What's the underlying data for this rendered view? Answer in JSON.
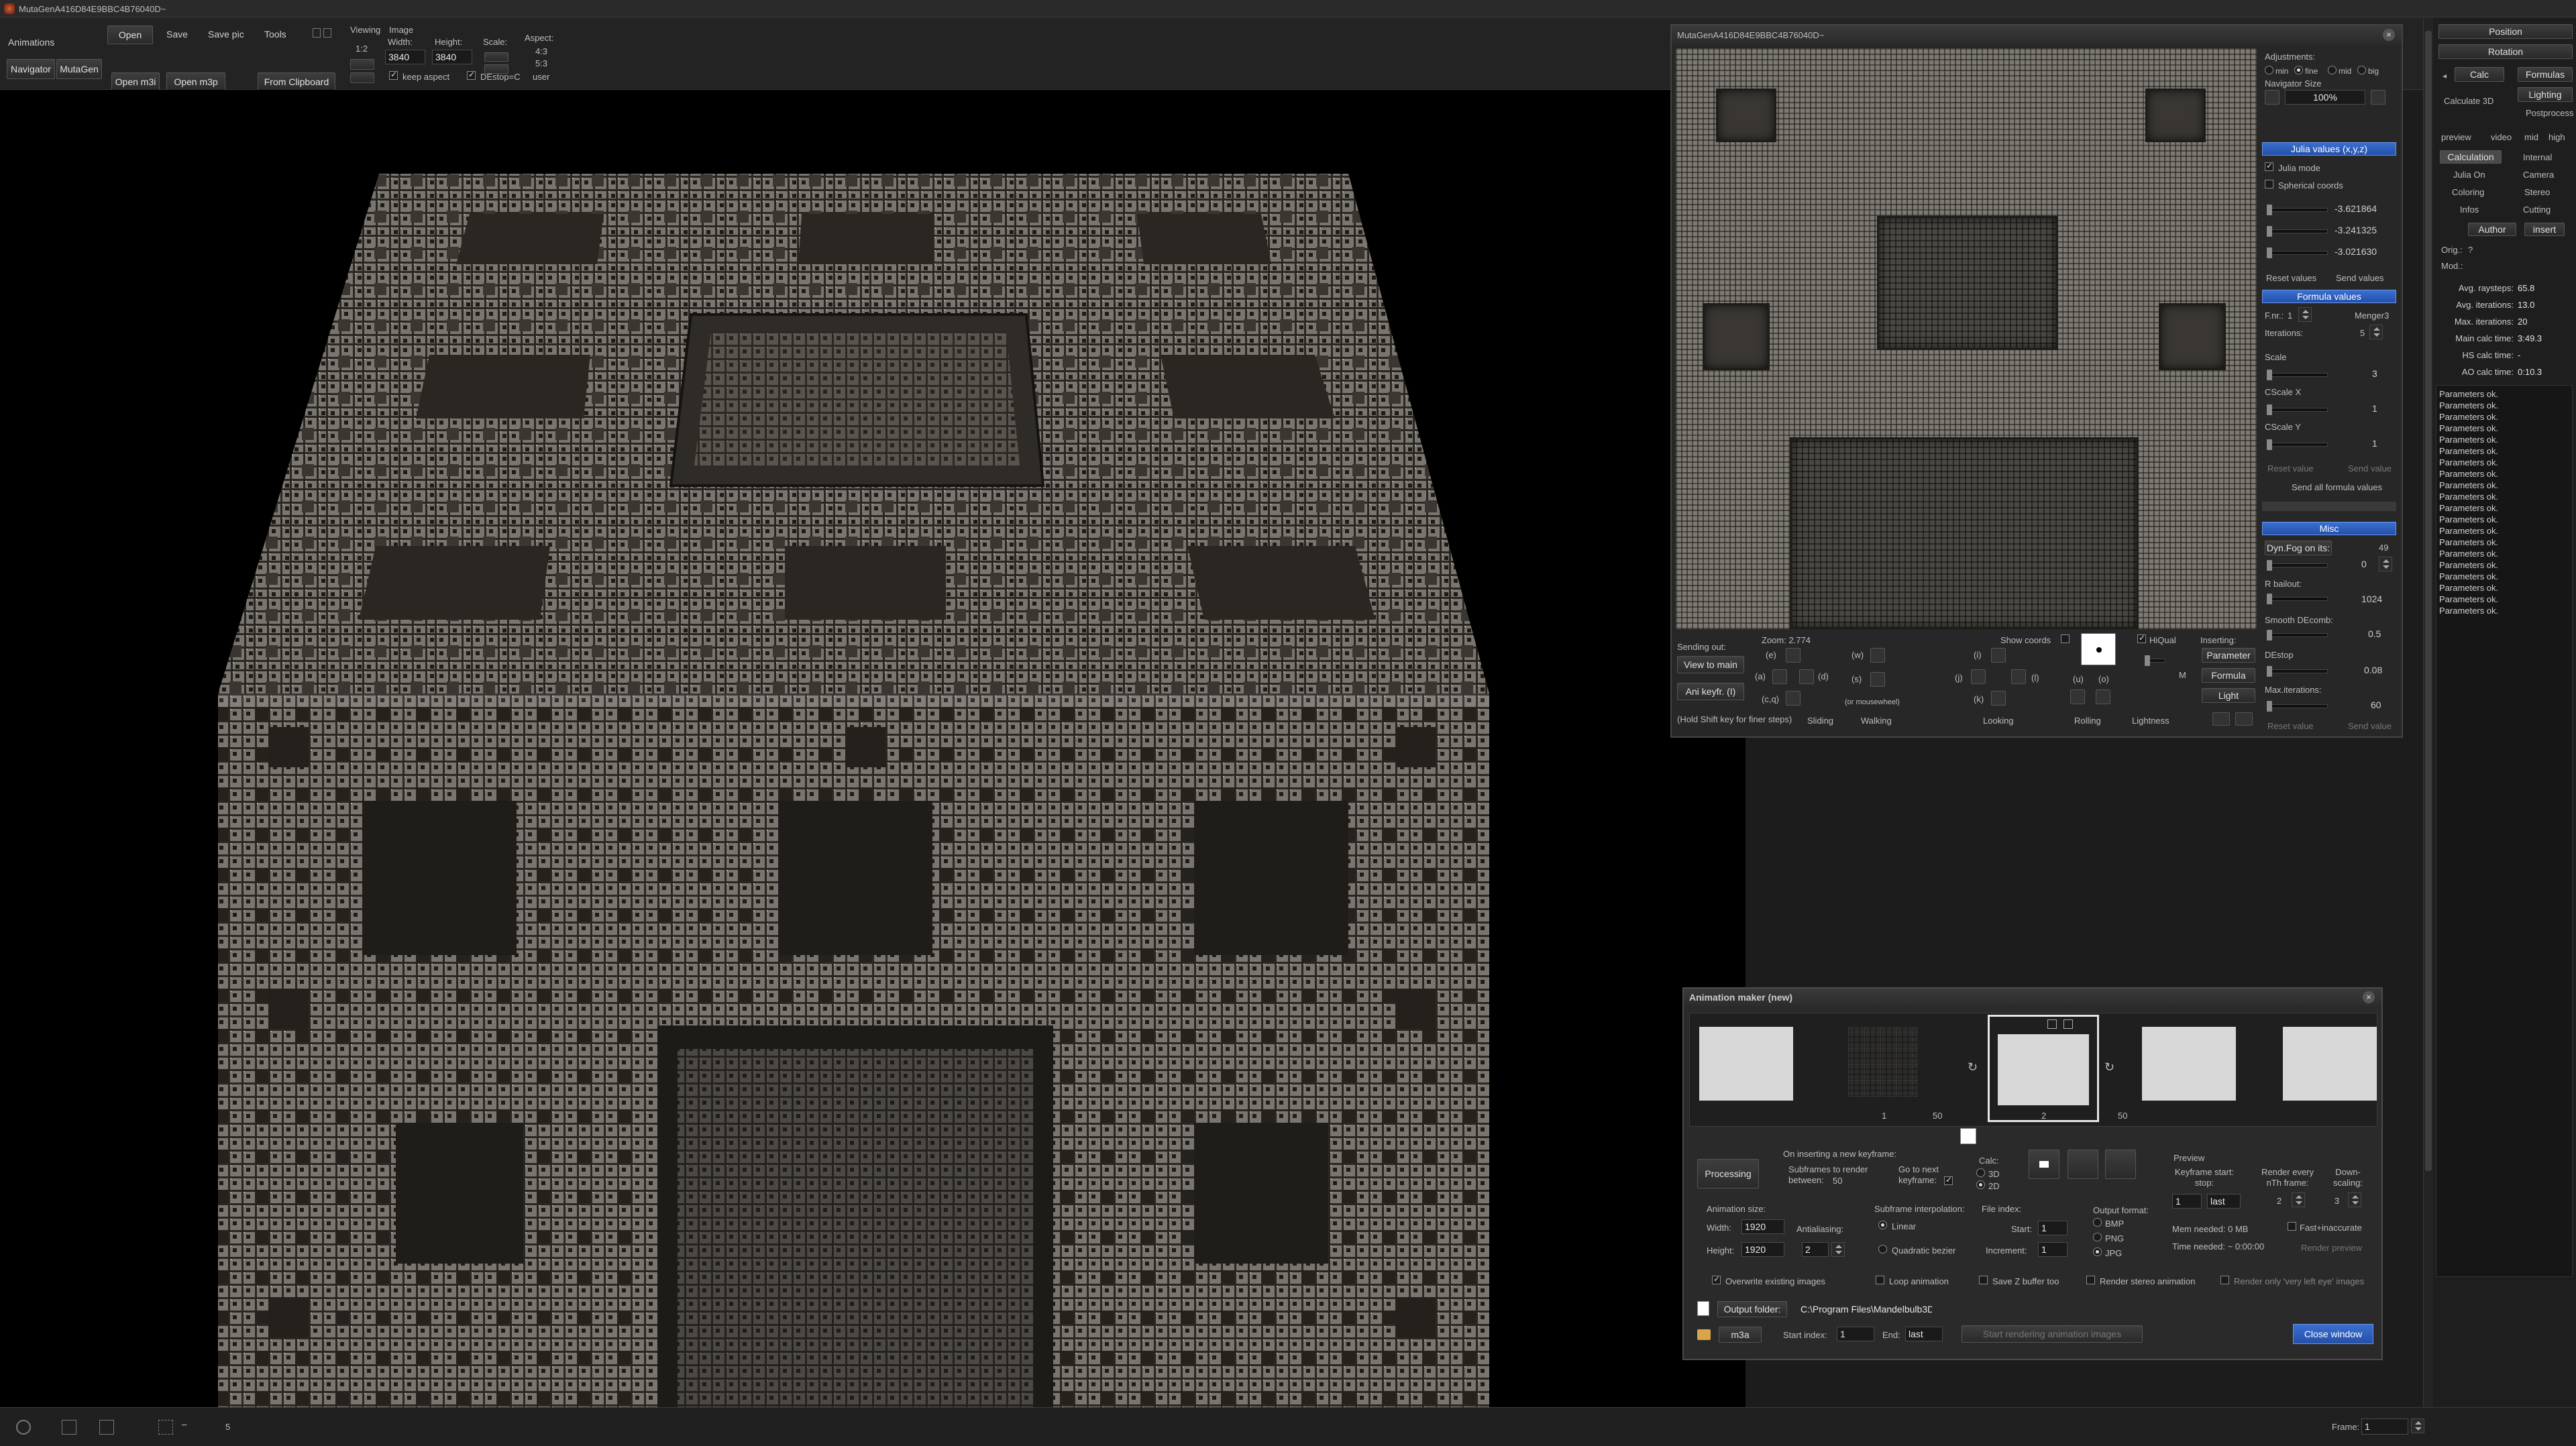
{
  "window_title": "MutaGenA416D84E9BBC4B76040D~",
  "toolbar": {
    "animations": "Animations",
    "navigator": "Navigator",
    "mutagen": "MutaGen",
    "open": "Open",
    "save": "Save",
    "save_pic": "Save pic",
    "tools": "Tools",
    "open_m3i": "Open m3i",
    "open_m3p": "Open m3p",
    "from_clipboard": "From Clipboard",
    "viewing_label": "Viewing",
    "viewing_value": "1:2",
    "image_label": "Image",
    "width_label": "Width:",
    "width_value": "3840",
    "height_label": "Height:",
    "height_value": "3840",
    "scale_label": "Scale:",
    "aspect_label": "Aspect:",
    "aspect_options": [
      "4:3",
      "5:3",
      "user"
    ],
    "keep_aspect": "keep aspect",
    "destop_c": "DEstop=C"
  },
  "navigator": {
    "title": "MutaGenA416D84E9BBC4B76040D~",
    "adjustments_label": "Adjustments:",
    "adj_options": [
      "min",
      "fine",
      "mid",
      "big"
    ],
    "navigator_size_label": "Navigator Size",
    "navigator_size_value": "100%",
    "julia_values_bar": "Julia values (x,y,z)",
    "julia_mode": "Julia mode",
    "spherical_coords": "Spherical coords",
    "julia_x": "-3.621864",
    "julia_y": "-3.241325",
    "julia_z": "-3.021630",
    "reset_values": "Reset values",
    "send_values": "Send values",
    "formula_values_bar": "Formula values",
    "fnr_label": "F.nr.:",
    "fnr_value": "1",
    "formula_name": "Menger3",
    "iterations_label": "Iterations:",
    "iterations_value": "5",
    "scale_label": "Scale",
    "scale_value": "3",
    "cscalex_label": "CScale X",
    "cscalex_value": "1",
    "cscaley_label": "CScale Y",
    "cscaley_value": "1",
    "reset_value": "Reset value",
    "send_value": "Send value",
    "send_all_formula": "Send all formula values",
    "misc_bar": "Misc",
    "dyn_fog_label": "Dyn.Fog on its:",
    "dyn_fog_value": "49",
    "dyn_fog_slider_value": "0",
    "rbailout_label": "R bailout:",
    "rbailout_value": "1024",
    "smooth_label": "Smooth DEcomb:",
    "smooth_value": "0.5",
    "destop_label": "DEstop",
    "destop_value": "0.08",
    "max_iter_label": "Max.iterations:",
    "max_iter_value": "60",
    "reset_value2": "Reset value",
    "send_value2": "Send value",
    "sending_out": "Sending out:",
    "view_to_main": "View to main",
    "ani_keyfr": "Ani keyfr. (I)",
    "zoom_label": "Zoom: 2.774",
    "show_coords": "Show coords",
    "hiqual": "HiQual",
    "inserting": "Inserting:",
    "parameter": "Parameter",
    "formula": "Formula",
    "light": "Light",
    "hold_shift": "(Hold Shift key for finer steps)",
    "sliding": "Sliding",
    "walking": "Walking",
    "looking": "Looking",
    "rolling": "Rolling",
    "lightness": "Lightness",
    "or_mousewheel": "(or mousewheel)",
    "key_labels": [
      "(e)",
      "(w)",
      "(i)",
      "(a)",
      "(d)",
      "(s)",
      "(j)",
      "(l)",
      "(u)",
      "(o)",
      "(c,q)",
      "(k)",
      "M"
    ]
  },
  "right_panel": {
    "position": "Position",
    "rotation": "Rotation",
    "calc": "Calc",
    "formulas": "Formulas",
    "calculate_3d": "Calculate 3D",
    "lighting": "Lighting",
    "postprocess": "Postprocess",
    "preview": "preview",
    "video": "video",
    "mid": "mid",
    "high": "high",
    "tabs": [
      "Calculation",
      "Internal",
      "Julia On",
      "Camera",
      "Coloring",
      "Stereo",
      "Infos",
      "Cutting"
    ],
    "author": "Author",
    "insert": "insert",
    "orig_label": "Orig.:",
    "orig_value": "?",
    "mod_label": "Mod.:",
    "stats": [
      {
        "label": "Avg. raysteps:",
        "value": "65.8"
      },
      {
        "label": "Avg. iterations:",
        "value": "13.0"
      },
      {
        "label": "Max. iterations:",
        "value": "20"
      },
      {
        "label": "Main calc time:",
        "value": "3:49.3"
      },
      {
        "label": "HS calc time:",
        "value": "-"
      },
      {
        "label": "AO calc time:",
        "value": "0:10.3"
      }
    ],
    "log": [
      "Parameters ok.",
      "Parameters ok.",
      "Parameters ok.",
      "Parameters ok.",
      "Parameters ok.",
      "Parameters ok.",
      "Parameters ok.",
      "Parameters ok.",
      "Parameters ok.",
      "Parameters ok.",
      "Parameters ok.",
      "Parameters ok.",
      "Parameters ok.",
      "Parameters ok.",
      "Parameters ok.",
      "Parameters ok.",
      "Parameters ok.",
      "Parameters ok.",
      "Parameters ok.",
      "Parameters ok."
    ]
  },
  "animation_maker": {
    "title": "Animation maker  (new)",
    "frame_numbers": [
      "1",
      "50",
      "2",
      "50"
    ],
    "processing": "Processing",
    "on_inserting": "On inserting a new keyframe:",
    "subframes_label": "Subframes to render between:",
    "subframes_value": "50",
    "go_to_next": "Go to next keyframe:",
    "calc_label": "Calc:",
    "calc_3d": "3D",
    "calc_2d": "2D",
    "preview_label": "Preview",
    "keyframe_label": "Keyframe start:  stop:",
    "keyframe_start": "1",
    "keyframe_stop": "last",
    "render_every_label": "Render every nTh frame:",
    "render_every_value": "2",
    "downscaling_label": "Down-scaling:",
    "downscaling_value": "3",
    "animation_size": "Animation size:",
    "width_label": "Width:",
    "width_value": "1920",
    "height_label": "Height:",
    "height_value": "1920",
    "antialiasing_label": "Antialiasing:",
    "antialiasing_value": "2",
    "subframe_interp": "Subframe interpolation:",
    "linear": "Linear",
    "quadratic": "Quadratic bezier",
    "file_index": "File index:",
    "start_label": "Start:",
    "start_value": "1",
    "increment_label": "Increment:",
    "increment_value": "1",
    "output_format": "Output format:",
    "formats": [
      "BMP",
      "PNG",
      "JPG"
    ],
    "mem_needed": "Mem needed:  0 MB",
    "time_needed": "Time needed:  ~ 0:00:00",
    "fast_inaccurate": "Fast+inaccurate",
    "render_preview": "Render preview",
    "overwrite": "Overwrite existing images",
    "loop": "Loop animation",
    "save_z": "Save Z buffer too",
    "render_stereo": "Render stereo animation",
    "render_only_left": "Render only 'very left eye' images",
    "output_folder": "Output folder:",
    "output_path": "C:\\Program Files\\Mandelbulb3Dv190\\",
    "m3a": "m3a",
    "start_index_label": "Start index:",
    "start_index_value": "1",
    "end_label": "End:",
    "end_value": "last",
    "start_rendering": "Start rendering animation images",
    "close_window": "Close window"
  },
  "status": {
    "zoom_value": "5",
    "frame_label": "Frame:",
    "frame_value": "1"
  }
}
